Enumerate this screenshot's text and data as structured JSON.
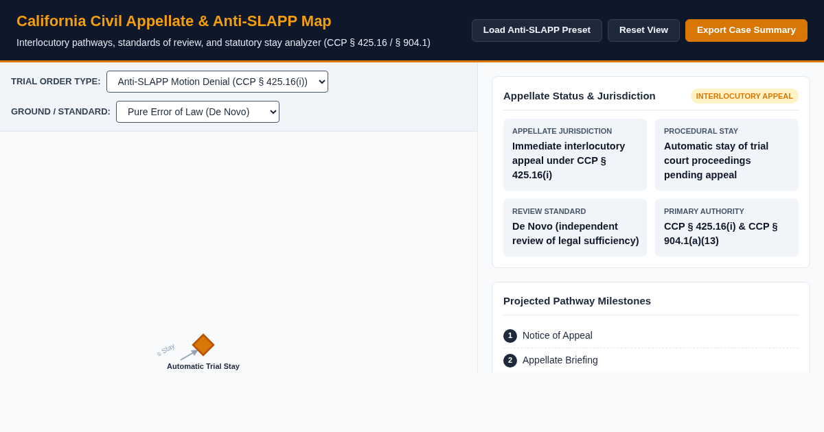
{
  "header": {
    "title": "California Civil Appellate & Anti-SLAPP Map",
    "subtitle": "Interlocutory pathways, standards of review, and statutory stay analyzer (CCP § 425.16 / § 904.1)",
    "buttons": [
      {
        "label": "Load Anti-SLAPP Preset",
        "kind": "secondary"
      },
      {
        "label": "Reset View",
        "kind": "secondary"
      },
      {
        "label": "Export Case Summary",
        "kind": "primary"
      }
    ]
  },
  "controls": [
    {
      "label": "TRIAL ORDER TYPE:",
      "value": "Anti-SLAPP Motion Denial (CCP § 425.16(i))"
    },
    {
      "label": "GROUND / STANDARD:",
      "value": "Pure Error of Law (De Novo)"
    }
  ],
  "diagram": {
    "nodes": [
      {
        "label": "Automatic Trial Stay",
        "kind": "decision"
      }
    ],
    "edges": [
      {
        "label": "s Stay"
      }
    ]
  },
  "status_card": {
    "title": "Appellate Status & Jurisdiction",
    "badge": "INTERLOCUTORY APPEAL",
    "fields": [
      {
        "label": "APPELLATE JURISDICTION",
        "value": "Immediate interlocutory appeal under CCP § 425.16(i)"
      },
      {
        "label": "PROCEDURAL STAY",
        "value": "Automatic stay of trial court proceedings pending appeal"
      },
      {
        "label": "REVIEW STANDARD",
        "value": "De Novo (independent review of legal sufficiency)"
      },
      {
        "label": "PRIMARY AUTHORITY",
        "value": "CCP § 425.16(i) & CCP § 904.1(a)(13)"
      }
    ]
  },
  "milestones_card": {
    "title": "Projected Pathway Milestones",
    "items": [
      {
        "number": "1",
        "label": "Notice of Appeal"
      },
      {
        "number": "2",
        "label": "Appellate Briefing"
      }
    ]
  }
}
